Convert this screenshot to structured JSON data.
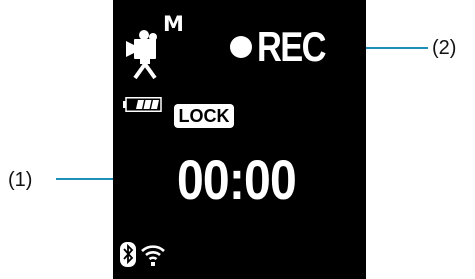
{
  "screen": {
    "camera_mode": "M",
    "record_status": "REC",
    "lock_label": "LOCK",
    "timecode": "00:00",
    "battery_level": 0.75
  },
  "callouts": {
    "left": "(1)",
    "right": "(2)"
  },
  "icons": {
    "camera": "movie-camera-icon",
    "record_dot": "record-dot-icon",
    "battery": "battery-icon",
    "bluetooth": "bluetooth-icon",
    "wifi": "wifi-icon"
  },
  "colors": {
    "screen_background": "#000000",
    "screen_foreground": "#ffffff",
    "leader_line": "#1f8fb8"
  }
}
